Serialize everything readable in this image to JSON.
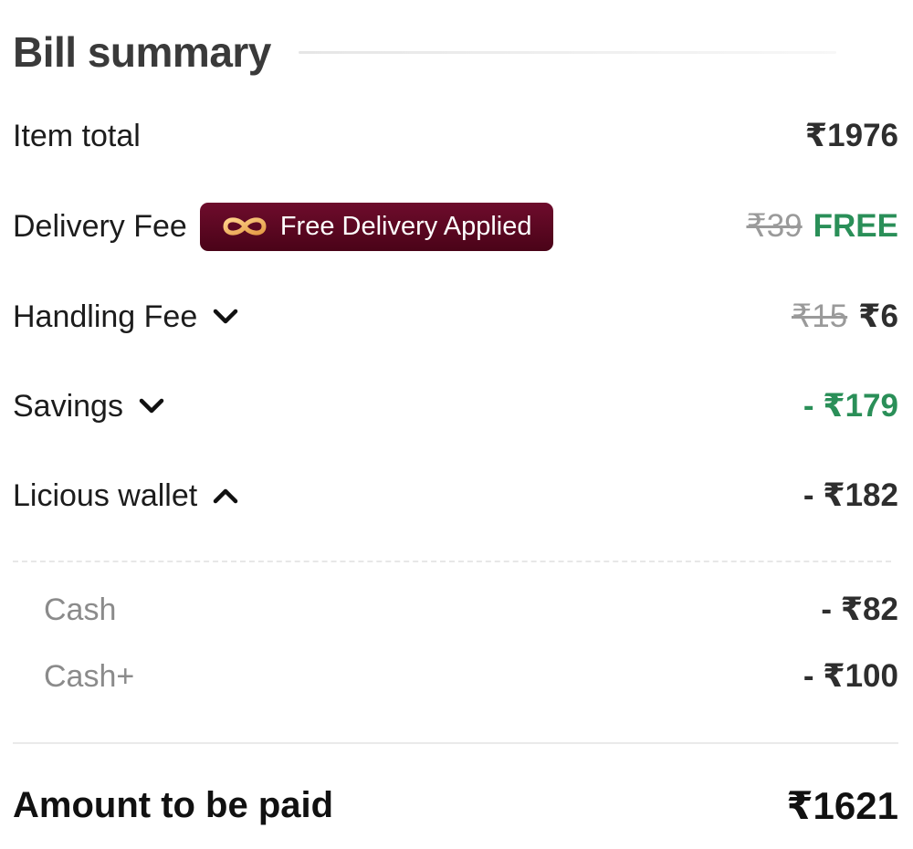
{
  "header": {
    "title": "Bill summary"
  },
  "rows": {
    "item_total": {
      "label": "Item total",
      "value": "₹1976"
    },
    "delivery_fee": {
      "label": "Delivery Fee",
      "badge": {
        "icon": "infinity-icon",
        "text": "Free Delivery Applied"
      },
      "original": "₹39",
      "value": "FREE"
    },
    "handling_fee": {
      "label": "Handling Fee",
      "expanded": false,
      "original": "₹15",
      "value": "₹6"
    },
    "savings": {
      "label": "Savings",
      "expanded": false,
      "value": "- ₹179"
    },
    "wallet": {
      "label": "Licious wallet",
      "expanded": true,
      "value": "- ₹182",
      "items": [
        {
          "label": "Cash",
          "value": "- ₹82"
        },
        {
          "label": "Cash+",
          "value": "- ₹100"
        }
      ]
    }
  },
  "total": {
    "label": "Amount to be paid",
    "value": "₹1621"
  },
  "colors": {
    "badge_bg": "#5a0620",
    "green": "#2a8f58",
    "strike": "#9a9a9a",
    "badge_icon": "#f3b66a"
  }
}
